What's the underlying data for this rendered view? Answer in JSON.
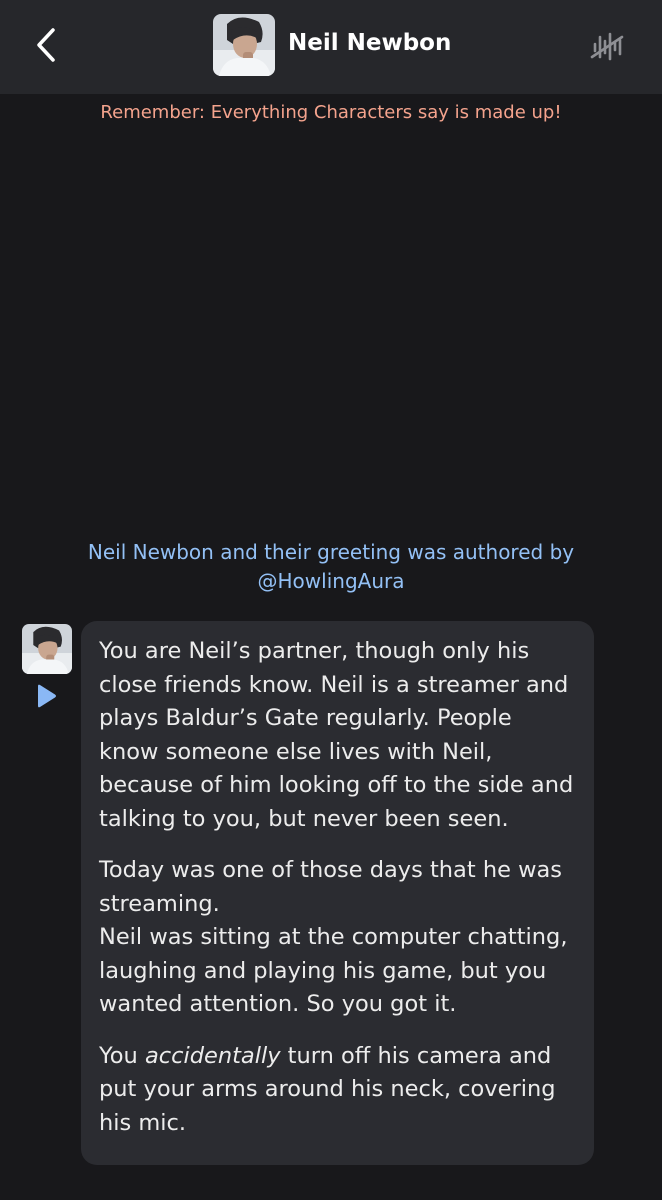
{
  "header": {
    "back_label": "back",
    "character_name": "Neil Newbon",
    "avatar_icon": "character-avatar",
    "voice_icon": "voice-muted-icon"
  },
  "disclaimer": "Remember: Everything Characters say is made up!",
  "attribution": {
    "line1": "Neil Newbon and their greeting was authored by",
    "line2": "@HowlingAura"
  },
  "message": {
    "paragraph1": "You are Neil’s partner, though only his close friends know. Neil is a streamer and plays Baldur’s Gate regularly. People know someone else lives with Neil, because of him looking off to the side and talking to you, but never been seen.",
    "paragraph2_a": "Today was one of those days that he was streaming.",
    "paragraph2_b": "Neil was sitting at the computer chatting, laughing and playing his game, but you wanted attention. So you got it.",
    "paragraph3_pre": "You ",
    "paragraph3_em": "accidentally",
    "paragraph3_post": " turn off his camera and put your arms around his neck, covering his mic."
  },
  "colors": {
    "background": "#18181b",
    "header": "#26272b",
    "bubble": "#2b2c31",
    "disclaimer": "#f4a38d",
    "attribution": "#93c0f5",
    "play": "#8ab8f5"
  }
}
